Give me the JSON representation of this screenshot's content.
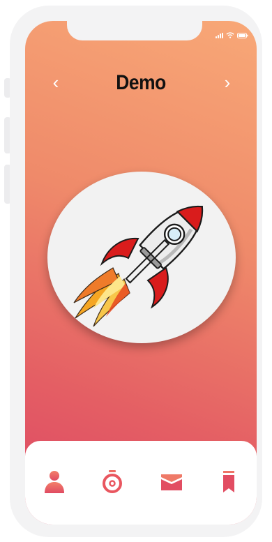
{
  "header": {
    "title": "Demo",
    "prev_label": "‹",
    "next_label": "›"
  },
  "status_bar": {
    "icons": [
      "signal-icon",
      "wifi-icon",
      "battery-icon"
    ]
  },
  "hero": {
    "image": "rocket-illustration"
  },
  "tabbar": {
    "items": [
      {
        "icon": "profile-icon"
      },
      {
        "icon": "stopwatch-icon"
      },
      {
        "icon": "mail-icon"
      },
      {
        "icon": "bookmark-icon"
      }
    ]
  },
  "colors": {
    "gradient_top": "#f8a877",
    "gradient_bottom": "#dc4664",
    "accent": "#e2505f",
    "title": "#111111"
  }
}
